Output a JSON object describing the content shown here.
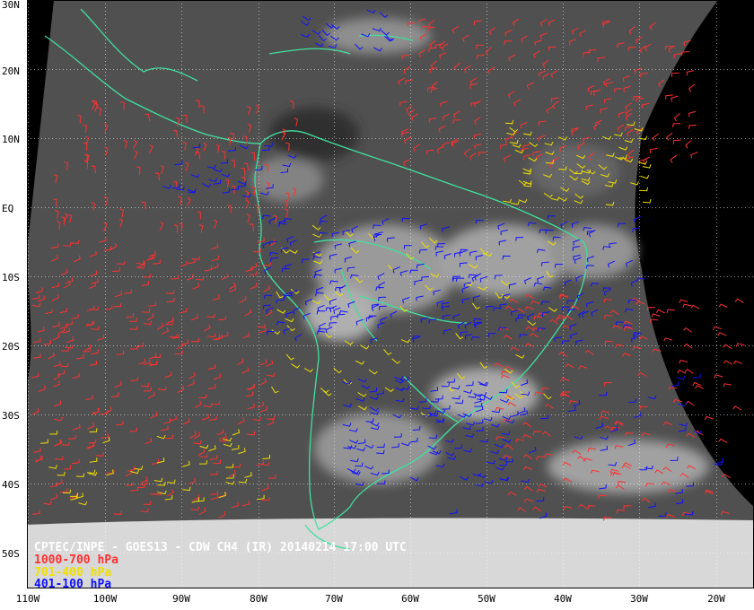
{
  "map": {
    "caption_title": "CPTEC/INPE - GOES13 - CDW CH4 (IR) 20140214 17:00 UTC",
    "legend": [
      {
        "label": "1000-700 hPa",
        "color": "#ff3030"
      },
      {
        "label": "701-400 hPa",
        "color": "#f0e000"
      },
      {
        "label": "401-100 hPa",
        "color": "#1010ff"
      }
    ],
    "lat_labels": [
      "30N",
      "20N",
      "10N",
      "EQ",
      "10S",
      "20S",
      "30S",
      "40S",
      "50S"
    ],
    "lon_labels": [
      "110W",
      "100W",
      "90W",
      "80W",
      "70W",
      "60W",
      "50W",
      "40W",
      "30W",
      "20W"
    ],
    "coastline_color": "#40e0a0",
    "grid_color": "#ffffff"
  }
}
